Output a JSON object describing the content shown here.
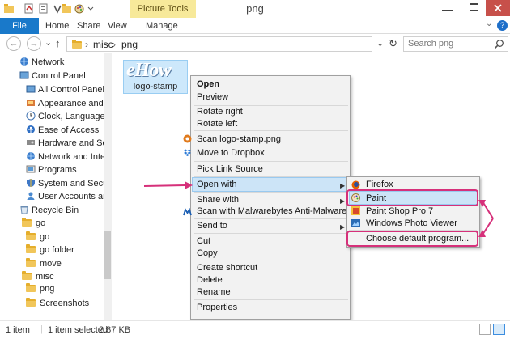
{
  "title_bar": {
    "window_title": "png",
    "picture_tools_label": "Picture Tools",
    "minimize_glyph": "—"
  },
  "ribbon": {
    "tabs": [
      "File",
      "Home",
      "Share",
      "View",
      "Manage"
    ],
    "help_glyph": "?"
  },
  "address_bar": {
    "back_glyph": "←",
    "forward_glyph": "→",
    "recent_glyph": "⌄",
    "up_glyph": "↑",
    "path": [
      "misc",
      "png"
    ],
    "separator": "›",
    "dropdown_glyph": "⌄",
    "refresh_glyph": "↻",
    "search_placeholder": "Search png"
  },
  "nav_pane": {
    "items": [
      {
        "label": "Network",
        "icon": "network-icon"
      },
      {
        "label": "Control Panel",
        "icon": "control-panel-icon"
      },
      {
        "label": "All Control Panel Ite",
        "icon": "control-panel-icon"
      },
      {
        "label": "Appearance and Pe",
        "icon": "appearance-icon"
      },
      {
        "label": "Clock, Language, ar",
        "icon": "clock-icon"
      },
      {
        "label": "Ease of Access",
        "icon": "ease-of-access-icon"
      },
      {
        "label": "Hardware and Soun",
        "icon": "hardware-icon"
      },
      {
        "label": "Network and Interne",
        "icon": "network-icon"
      },
      {
        "label": "Programs",
        "icon": "programs-icon"
      },
      {
        "label": "System and Security",
        "icon": "security-icon"
      },
      {
        "label": "User Accounts and I",
        "icon": "user-accounts-icon"
      },
      {
        "label": "Recycle Bin",
        "icon": "recycle-bin-icon"
      },
      {
        "label": "go",
        "icon": "folder-icon"
      },
      {
        "label": "go",
        "icon": "folder-icon"
      },
      {
        "label": "go folder",
        "icon": "folder-icon"
      },
      {
        "label": "move",
        "icon": "folder-icon"
      },
      {
        "label": "misc",
        "icon": "folder-icon"
      },
      {
        "label": "png",
        "icon": "folder-icon"
      },
      {
        "label": "Screenshots",
        "icon": "folder-icon"
      }
    ]
  },
  "file": {
    "logo_text": "eHow",
    "name": "logo-stamp"
  },
  "context_menu": {
    "items": [
      "Open",
      "Preview",
      "Rotate right",
      "Rotate left",
      "Scan logo-stamp.png",
      "Move to Dropbox",
      "Pick Link Source",
      "Open with",
      "Share with",
      "Scan with Malwarebytes Anti-Malware",
      "Send to",
      "Cut",
      "Copy",
      "Create shortcut",
      "Delete",
      "Rename",
      "Properties"
    ],
    "submenu_arrow": "▶"
  },
  "open_with_submenu": {
    "items": [
      "Firefox",
      "Paint",
      "Paint Shop Pro 7",
      "Windows Photo Viewer",
      "Choose default program..."
    ]
  },
  "status_bar": {
    "item_count": "1 item",
    "selection": "1 item selected",
    "size": "2.87 KB"
  },
  "colors": {
    "accent": "#1979ca",
    "callout": "#d6307a",
    "highlight": "#cce4f7",
    "picture_tools": "#f7e99a"
  }
}
